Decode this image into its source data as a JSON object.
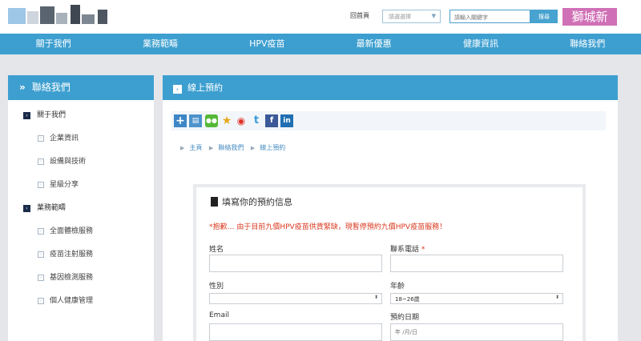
{
  "header": {
    "home_link": "回首頁",
    "region_select": "請選選擇",
    "search_placeholder": "請輸入關鍵字",
    "search_button": "搜尋",
    "brand_badge": "獅城新"
  },
  "nav": {
    "items": [
      "關于我們",
      "業務範疇",
      "HPV疫苗",
      "最新優惠",
      "健康資訊",
      "聯絡我們"
    ]
  },
  "sidebar": {
    "title": "聯絡我們",
    "groups": [
      {
        "label": "關于我們",
        "items": [
          "企業資訊",
          "設備與技術",
          "星級分享"
        ]
      },
      {
        "label": "業務範疇",
        "items": [
          "全面體檢服務",
          "疫苗注射服務",
          "基因檢測服務",
          "個人健康管理"
        ]
      }
    ]
  },
  "panel": {
    "title": "線上預約",
    "share_icons": [
      "plus-share-icon",
      "print-icon",
      "wechat-icon",
      "favorite-star-icon",
      "weibo-icon",
      "tencent-weibo-icon",
      "facebook-icon",
      "linkedin-icon"
    ],
    "breadcrumb": [
      "主頁",
      "聯絡我們",
      "線上預約"
    ]
  },
  "form": {
    "title": "填寫你的預約信息",
    "notice": "*抱歉… 由于目前九價HPV疫苗供貨緊缺，現暫停預約九價HPV疫苗服務！",
    "name_label": "姓名",
    "phone_label": "聯系電話",
    "phone_required": "*",
    "gender_label": "性別",
    "gender_value": "",
    "age_label": "年齡",
    "age_value": "18~26歲",
    "email_label": "Email",
    "date_label": "預約日期",
    "date_placeholder": "年 /月/日"
  },
  "colors": {
    "nav_blue": "#3d9fd0",
    "notice_red": "#d9381e",
    "badge_pink": "#d070b6"
  }
}
